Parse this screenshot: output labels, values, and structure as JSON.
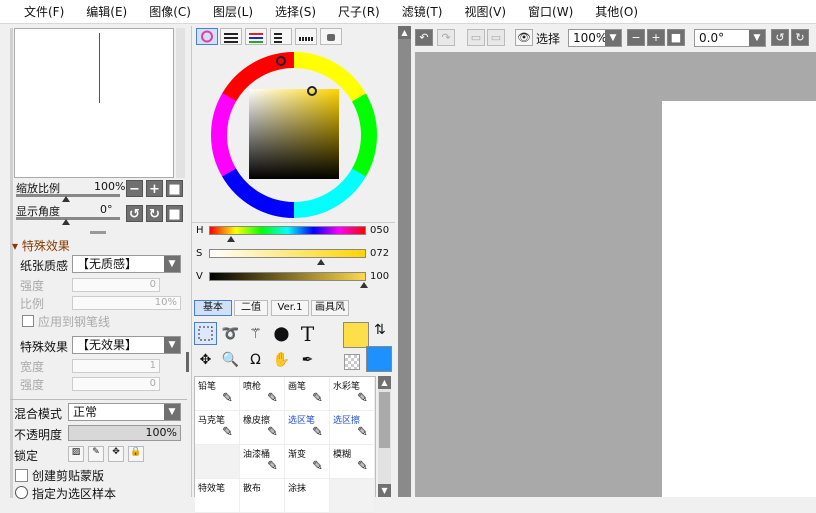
{
  "menu": [
    "文件(F)",
    "编辑(E)",
    "图像(C)",
    "图层(L)",
    "选择(S)",
    "尺子(R)",
    "滤镜(T)",
    "视图(V)",
    "窗口(W)",
    "其他(O)"
  ],
  "navigator": {
    "zoom_label": "缩放比例",
    "zoom_value": "100%",
    "angle_label": "显示角度",
    "angle_value": "0°"
  },
  "effects": {
    "section": "特殊效果",
    "paper_label": "纸张质感",
    "paper_value": "【无质感】",
    "strength_label": "强度",
    "strength_value": "0",
    "scale_label": "比例",
    "scale_value": "10%",
    "apply_label": "应用到钢笔线",
    "effect_label": "特殊效果",
    "effect_value": "【无效果】",
    "width_label": "宽度",
    "width_value": "1",
    "strength2_label": "强度",
    "strength2_value": "0"
  },
  "layer": {
    "blend_label": "混合模式",
    "blend_value": "正常",
    "opacity_label": "不透明度",
    "opacity_value": "100%",
    "lock_label": "锁定",
    "clip_label": "创建剪贴蒙版",
    "selsrc_label": "指定为选区样本"
  },
  "color": {
    "h_label": "H",
    "h_value": "050",
    "s_label": "S",
    "s_value": "072",
    "v_label": "V",
    "v_value": "100",
    "h": 50,
    "s": 72,
    "v": 100,
    "primary": "#ffdf48",
    "secondary": "#1e90ff"
  },
  "tool_tabs": [
    "基本",
    "二值",
    "Ver.1",
    "画具风"
  ],
  "brushes": [
    {
      "name": "铅笔",
      "blue": false,
      "icon": "pencil-icon"
    },
    {
      "name": "喷枪",
      "blue": false,
      "icon": "airbrush-icon"
    },
    {
      "name": "画笔",
      "blue": false,
      "icon": "brush-icon"
    },
    {
      "name": "水彩笔",
      "blue": false,
      "icon": "watercolor-icon"
    },
    {
      "name": "马克笔",
      "blue": false,
      "icon": "marker-icon"
    },
    {
      "name": "橡皮擦",
      "blue": false,
      "icon": "eraser-icon"
    },
    {
      "name": "选区笔",
      "blue": true,
      "icon": "selpen-icon"
    },
    {
      "name": "选区擦",
      "blue": true,
      "icon": "selerase-icon"
    },
    {
      "name": "",
      "blue": false,
      "icon": ""
    },
    {
      "name": "油漆桶",
      "blue": false,
      "icon": "bucket-icon"
    },
    {
      "name": "渐变",
      "blue": false,
      "icon": "gradient-icon"
    },
    {
      "name": "模糊",
      "blue": false,
      "icon": "blur-icon"
    },
    {
      "name": "特效笔",
      "blue": false,
      "icon": ""
    },
    {
      "name": "散布",
      "blue": false,
      "icon": ""
    },
    {
      "name": "涂抹",
      "blue": false,
      "icon": ""
    },
    {
      "name": "",
      "blue": false,
      "icon": ""
    }
  ],
  "canvas_toolbar": {
    "select_label": "选择",
    "zoom_value": "100%",
    "angle_value": "0.0°"
  }
}
